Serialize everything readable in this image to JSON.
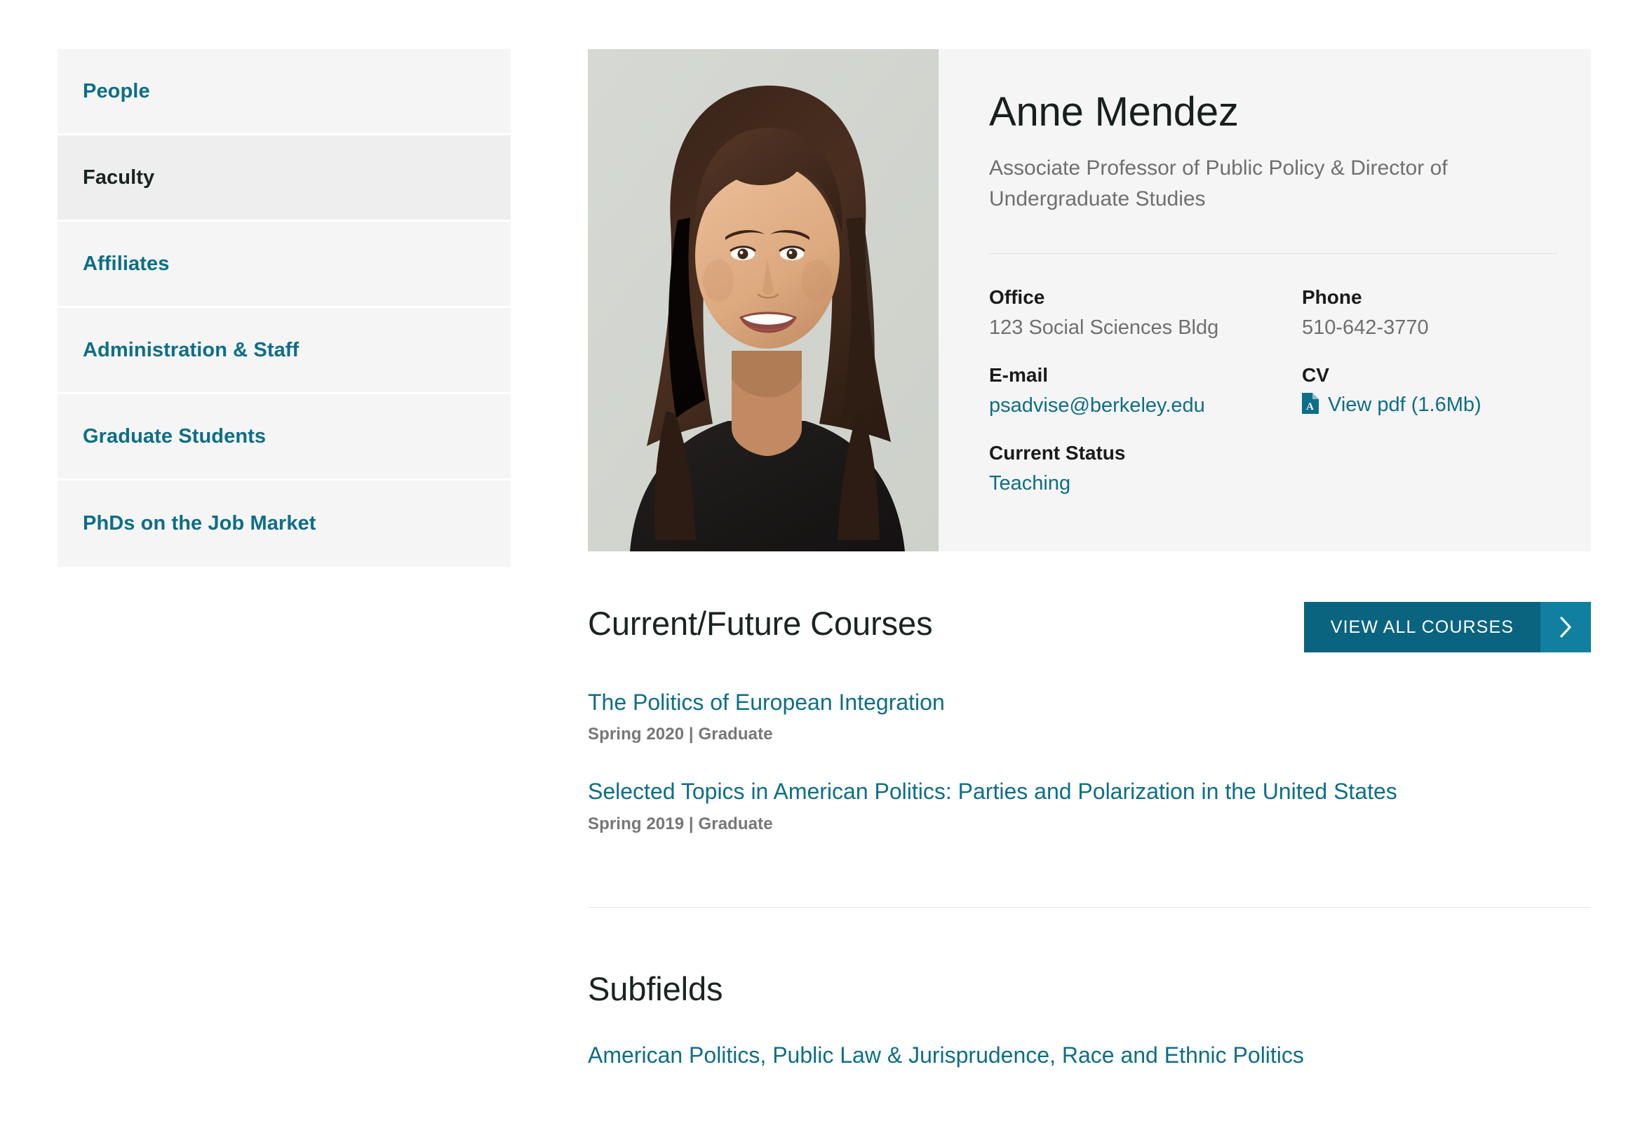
{
  "sidebar": {
    "items": [
      {
        "label": "People",
        "active": false
      },
      {
        "label": "Faculty",
        "active": true
      },
      {
        "label": "Affiliates",
        "active": false
      },
      {
        "label": "Administration & Staff",
        "active": false
      },
      {
        "label": "Graduate Students",
        "active": false
      },
      {
        "label": "PhDs on the Job Market",
        "active": false
      }
    ]
  },
  "profile": {
    "name": "Anne Mendez",
    "title": "Associate Professor of Public Policy & Director of Undergraduate Studies",
    "photo_alt": "portrait-photo",
    "contact": {
      "office_label": "Office",
      "office_value": "123 Social Sciences Bldg",
      "phone_label": "Phone",
      "phone_value": "510-642-3770",
      "email_label": "E-mail",
      "email_value": "psadvise@berkeley.edu",
      "cv_label": "CV",
      "cv_value": "View pdf (1.6Mb)",
      "status_label": "Current Status",
      "status_value": "Teaching"
    }
  },
  "courses": {
    "heading": "Current/Future Courses",
    "view_all_label": "VIEW ALL COURSES",
    "items": [
      {
        "title": "The Politics of European Integration",
        "meta": "Spring 2020 | Graduate"
      },
      {
        "title": "Selected Topics in American Politics: Parties and Polarization in the United States",
        "meta": "Spring 2019 | Graduate"
      }
    ]
  },
  "subfields": {
    "heading": "Subfields",
    "value": "American Politics, Public Law & Jurisprudence, Race and Ethnic Politics"
  },
  "colors": {
    "link": "#0d6e87",
    "button": "#0a6480",
    "button_arrow": "#1180a0",
    "card_bg": "#f5f5f5",
    "nav_active_bg": "#eeeeee"
  }
}
